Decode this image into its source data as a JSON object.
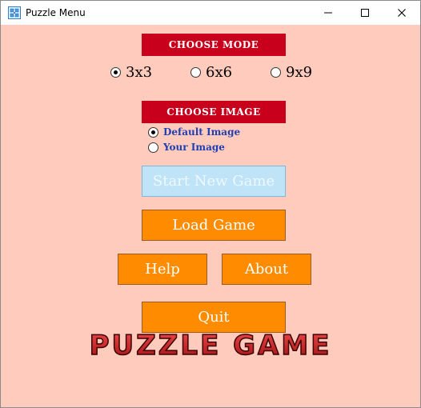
{
  "window": {
    "title": "Puzzle Menu",
    "minimize_glyph": "—",
    "maximize_glyph": "☐",
    "close_glyph": "✕"
  },
  "mode": {
    "header": "CHOOSE MODE",
    "options": [
      {
        "label": "3x3",
        "selected": true
      },
      {
        "label": "6x6",
        "selected": false
      },
      {
        "label": "9x9",
        "selected": false
      }
    ]
  },
  "image": {
    "header": "CHOOSE IMAGE",
    "options": [
      {
        "label": "Default Image",
        "selected": true
      },
      {
        "label": "Your Image",
        "selected": false
      }
    ]
  },
  "buttons": {
    "start": "Start New Game",
    "load": "Load Game",
    "help": "Help",
    "about": "About",
    "quit": "Quit"
  },
  "logo": {
    "text": "PUZZLE GAME"
  },
  "colors": {
    "background": "#ffcbbd",
    "header": "#c8001c",
    "button": "#ff8c00",
    "disabled_button": "#bfe4f7",
    "option_text": "#1f3fb3"
  }
}
